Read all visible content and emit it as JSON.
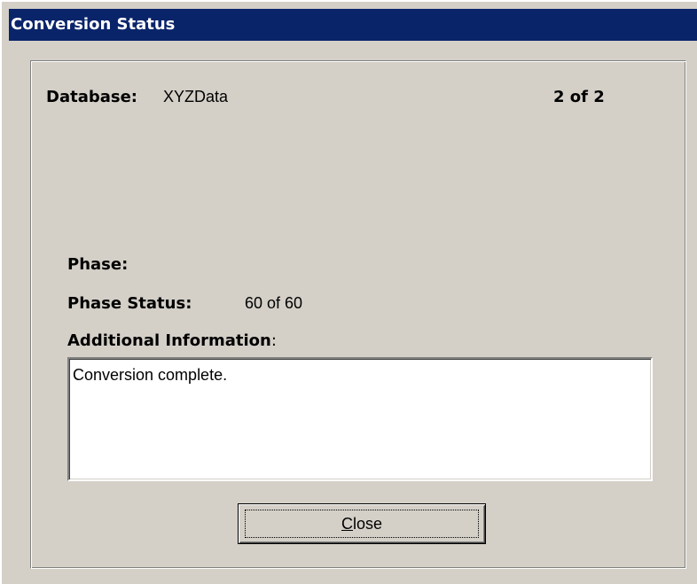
{
  "window": {
    "title": "Conversion Status"
  },
  "database": {
    "label": "Database:",
    "value": "XYZData",
    "count": "2 of 2"
  },
  "phase": {
    "label": "Phase:",
    "value": ""
  },
  "phase_status": {
    "label": "Phase Status:",
    "value": "60 of 60"
  },
  "additional_info": {
    "label": "Additional Information",
    "colon": ":",
    "text": "Conversion complete."
  },
  "buttons": {
    "close_mnemonic": "C",
    "close_rest": "lose"
  },
  "colors": {
    "titlebar": "#0a246a",
    "face": "#d4d0c8"
  }
}
